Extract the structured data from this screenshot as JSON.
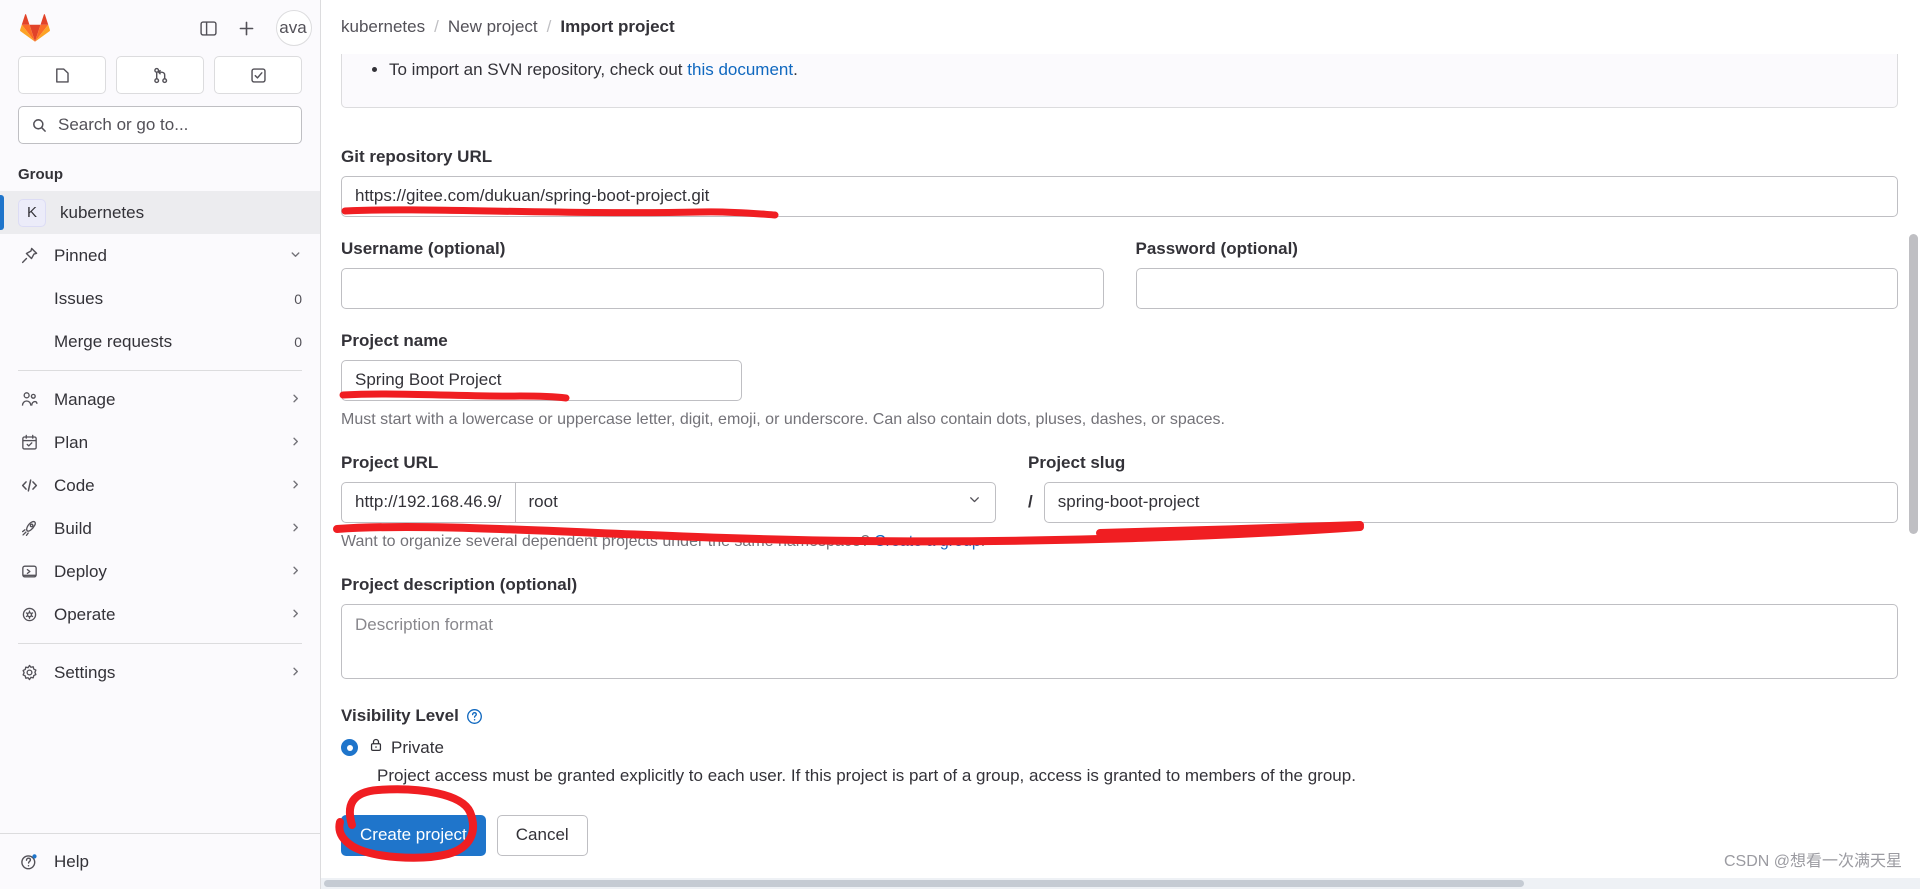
{
  "sidebar": {
    "logo_alt": "gitlab-logo",
    "top_actions": [
      {
        "name": "toggle-sidebar-icon",
        "label": ""
      },
      {
        "name": "new-item-icon",
        "label": ""
      }
    ],
    "avatar_text": "ava",
    "quick_buttons": [
      {
        "name": "issues-quick-icon",
        "label": ""
      },
      {
        "name": "merge-requests-quick-icon",
        "label": ""
      },
      {
        "name": "todos-quick-icon",
        "label": ""
      }
    ],
    "search": {
      "placeholder": "Search or go to..."
    },
    "section_label": "Group",
    "group": {
      "initial": "K",
      "label": "kubernetes"
    },
    "items": [
      {
        "label": "Pinned",
        "count": "",
        "icon": "pin-icon",
        "chevron": "down"
      },
      {
        "label": "Issues",
        "count": "0",
        "icon": "",
        "chevron": ""
      },
      {
        "label": "Merge requests",
        "count": "0",
        "icon": "",
        "chevron": ""
      },
      {
        "label": "Manage",
        "count": "",
        "icon": "users-icon",
        "chevron": "right"
      },
      {
        "label": "Plan",
        "count": "",
        "icon": "calendar-icon",
        "chevron": "right"
      },
      {
        "label": "Code",
        "count": "",
        "icon": "code-icon",
        "chevron": "right"
      },
      {
        "label": "Build",
        "count": "",
        "icon": "rocket-icon",
        "chevron": "right"
      },
      {
        "label": "Deploy",
        "count": "",
        "icon": "deploy-icon",
        "chevron": "right"
      },
      {
        "label": "Operate",
        "count": "",
        "icon": "cloud-gear-icon",
        "chevron": "right"
      },
      {
        "label": "Settings",
        "count": "",
        "icon": "gear-icon",
        "chevron": "right"
      }
    ],
    "help": {
      "label": "Help",
      "icon": "help-icon",
      "has_notification_dot": true
    }
  },
  "breadcrumb": {
    "group": "kubernetes",
    "parent": "New project",
    "current": "Import project",
    "separator": "/"
  },
  "alert": {
    "bullet_prefix": "To import an SVN repository, check out ",
    "link_text": "this document",
    "bullet_suffix": "."
  },
  "form": {
    "git_url": {
      "label": "Git repository URL",
      "value": "https://gitee.com/dukuan/spring-boot-project.git",
      "placeholder": ""
    },
    "username": {
      "label": "Username (optional)",
      "value": "",
      "placeholder": ""
    },
    "password": {
      "label": "Password (optional)",
      "value": "",
      "placeholder": ""
    },
    "project_name": {
      "label": "Project name",
      "value": "Spring Boot Project",
      "placeholder": "",
      "hint": "Must start with a lowercase or uppercase letter, digit, emoji, or underscore. Can also contain dots, pluses, dashes, or spaces."
    },
    "project_url": {
      "label": "Project URL",
      "prefix": "http://192.168.46.9/",
      "namespace": "root",
      "separator": "/",
      "hint_text": "Want to organize several dependent projects under the same namespace? ",
      "hint_link": "Create a group",
      "hint_suffix": "."
    },
    "project_slug": {
      "label": "Project slug",
      "value": "spring-boot-project",
      "placeholder": ""
    },
    "description": {
      "label": "Project description (optional)",
      "value": "",
      "placeholder": "Description format"
    },
    "visibility": {
      "label": "Visibility Level",
      "help_icon": "question-circle-icon",
      "selected": "Private",
      "options": [
        {
          "name": "Private",
          "icon": "lock-icon",
          "description": "Project access must be granted explicitly to each user. If this project is part of a group, access is granted to members of the group.",
          "selected": true
        }
      ]
    },
    "actions": {
      "submit_label": "Create project",
      "cancel_label": "Cancel"
    }
  },
  "watermark": "CSDN @想看一次满天星",
  "colors": {
    "accent": "#1f75cb",
    "link": "#1068bf",
    "annotation": "#f01e22",
    "sidebar_bg": "#fbfafd",
    "border": "#dcdcde"
  }
}
